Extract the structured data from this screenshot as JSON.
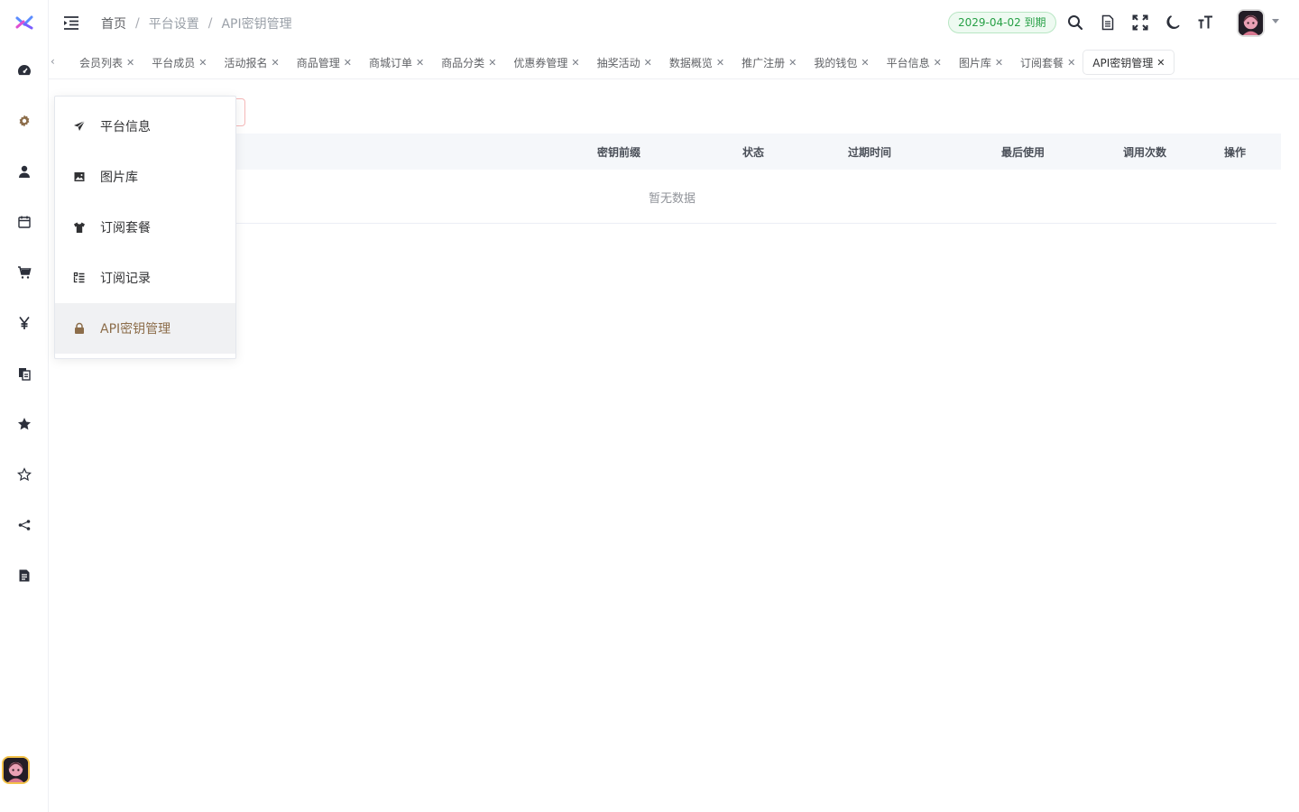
{
  "header": {
    "breadcrumb": [
      "首页",
      "平台设置",
      "API密钥管理"
    ],
    "breadcrumb_sep": "/",
    "expiry_badge": "2029-04-02 到期"
  },
  "tabs": {
    "prev_arrow": "‹",
    "close_glyph": "✕",
    "items": [
      {
        "label": "会员列表"
      },
      {
        "label": "平台成员"
      },
      {
        "label": "活动报名"
      },
      {
        "label": "商品管理"
      },
      {
        "label": "商城订单"
      },
      {
        "label": "商品分类"
      },
      {
        "label": "优惠券管理"
      },
      {
        "label": "抽奖活动"
      },
      {
        "label": "数据概览"
      },
      {
        "label": "推广注册"
      },
      {
        "label": "我的钱包"
      },
      {
        "label": "平台信息"
      },
      {
        "label": "图片库"
      },
      {
        "label": "订阅套餐"
      },
      {
        "label": "API密钥管理",
        "active": true
      }
    ]
  },
  "table": {
    "columns": [
      "密钥前缀",
      "状态",
      "过期时间",
      "最后使用",
      "调用次数",
      "操作"
    ],
    "empty_text": "暂无数据"
  },
  "flyout": {
    "items": [
      {
        "label": "平台信息",
        "icon": "send-icon"
      },
      {
        "label": "图片库",
        "icon": "image-icon"
      },
      {
        "label": "订阅套餐",
        "icon": "shirt-icon"
      },
      {
        "label": "订阅记录",
        "icon": "list-icon"
      },
      {
        "label": "API密钥管理",
        "icon": "lock-icon",
        "active": true
      }
    ]
  },
  "sidebar": {
    "icons": [
      "dashboard-icon",
      "gear-icon",
      "user-icon",
      "calendar-icon",
      "cart-icon",
      "yen-icon",
      "copy-icon",
      "star-icon",
      "star-outline-icon",
      "share-icon",
      "document-icon"
    ]
  },
  "colors": {
    "accent": "#8c6d4a",
    "expiry_green": "#27a046",
    "table_header_bg": "#f5f7fa"
  }
}
